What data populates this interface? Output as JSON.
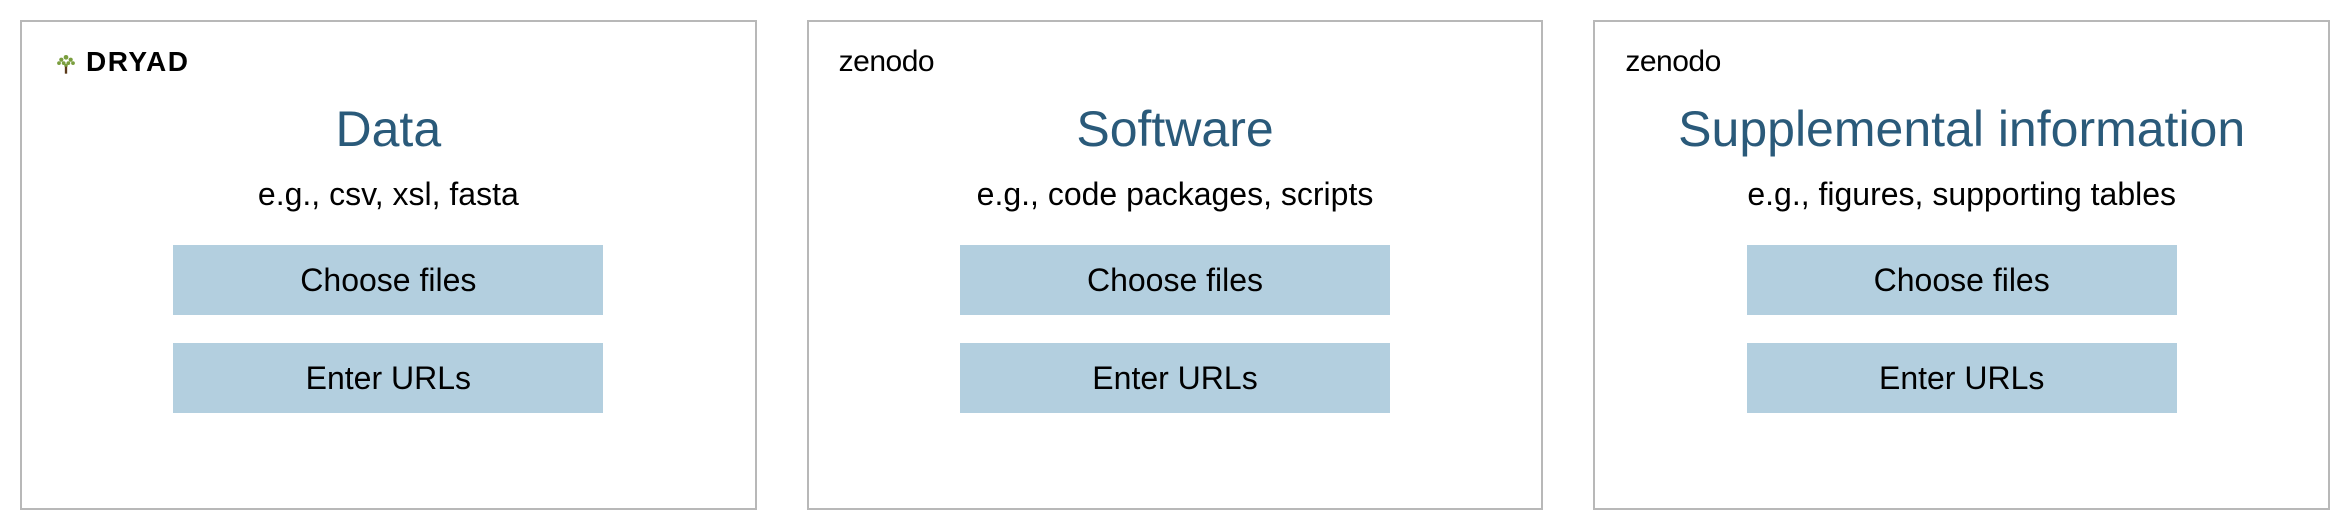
{
  "panels": [
    {
      "logo": "dryad",
      "logo_text": "DRYAD",
      "title": "Data",
      "subtitle": "e.g., csv, xsl, fasta",
      "choose_label": "Choose files",
      "urls_label": "Enter URLs"
    },
    {
      "logo": "zenodo",
      "logo_text": "zenodo",
      "title": "Software",
      "subtitle": "e.g., code packages, scripts",
      "choose_label": "Choose files",
      "urls_label": "Enter URLs"
    },
    {
      "logo": "zenodo",
      "logo_text": "zenodo",
      "title": "Supplemental information",
      "subtitle": "e.g., figures, supporting tables",
      "choose_label": "Choose files",
      "urls_label": "Enter URLs"
    }
  ]
}
